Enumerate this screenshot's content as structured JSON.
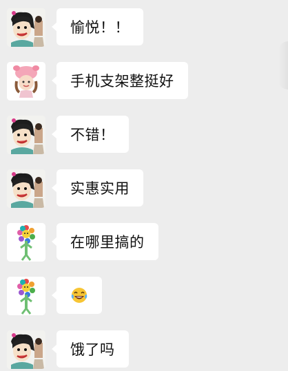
{
  "colors": {
    "background": "#ededed",
    "bubble": "#ffffff",
    "text": "#111111"
  },
  "avatars": {
    "cartoon_face": "cartoon-face-avatar",
    "pig_doll": "pig-doll-avatar",
    "sunflower": "sunflower-figure-avatar"
  },
  "messages": [
    {
      "avatar": "cartoon_face",
      "text": "愉悦！！"
    },
    {
      "avatar": "pig_doll",
      "text": "手机支架整挺好"
    },
    {
      "avatar": "cartoon_face",
      "text": "不错！"
    },
    {
      "avatar": "cartoon_face",
      "text": "实惠实用"
    },
    {
      "avatar": "sunflower",
      "text": "在哪里搞的"
    },
    {
      "avatar": "sunflower",
      "emoji": "laughing-with-tears-emoji"
    },
    {
      "avatar": "cartoon_face",
      "text": "饿了吗"
    }
  ]
}
